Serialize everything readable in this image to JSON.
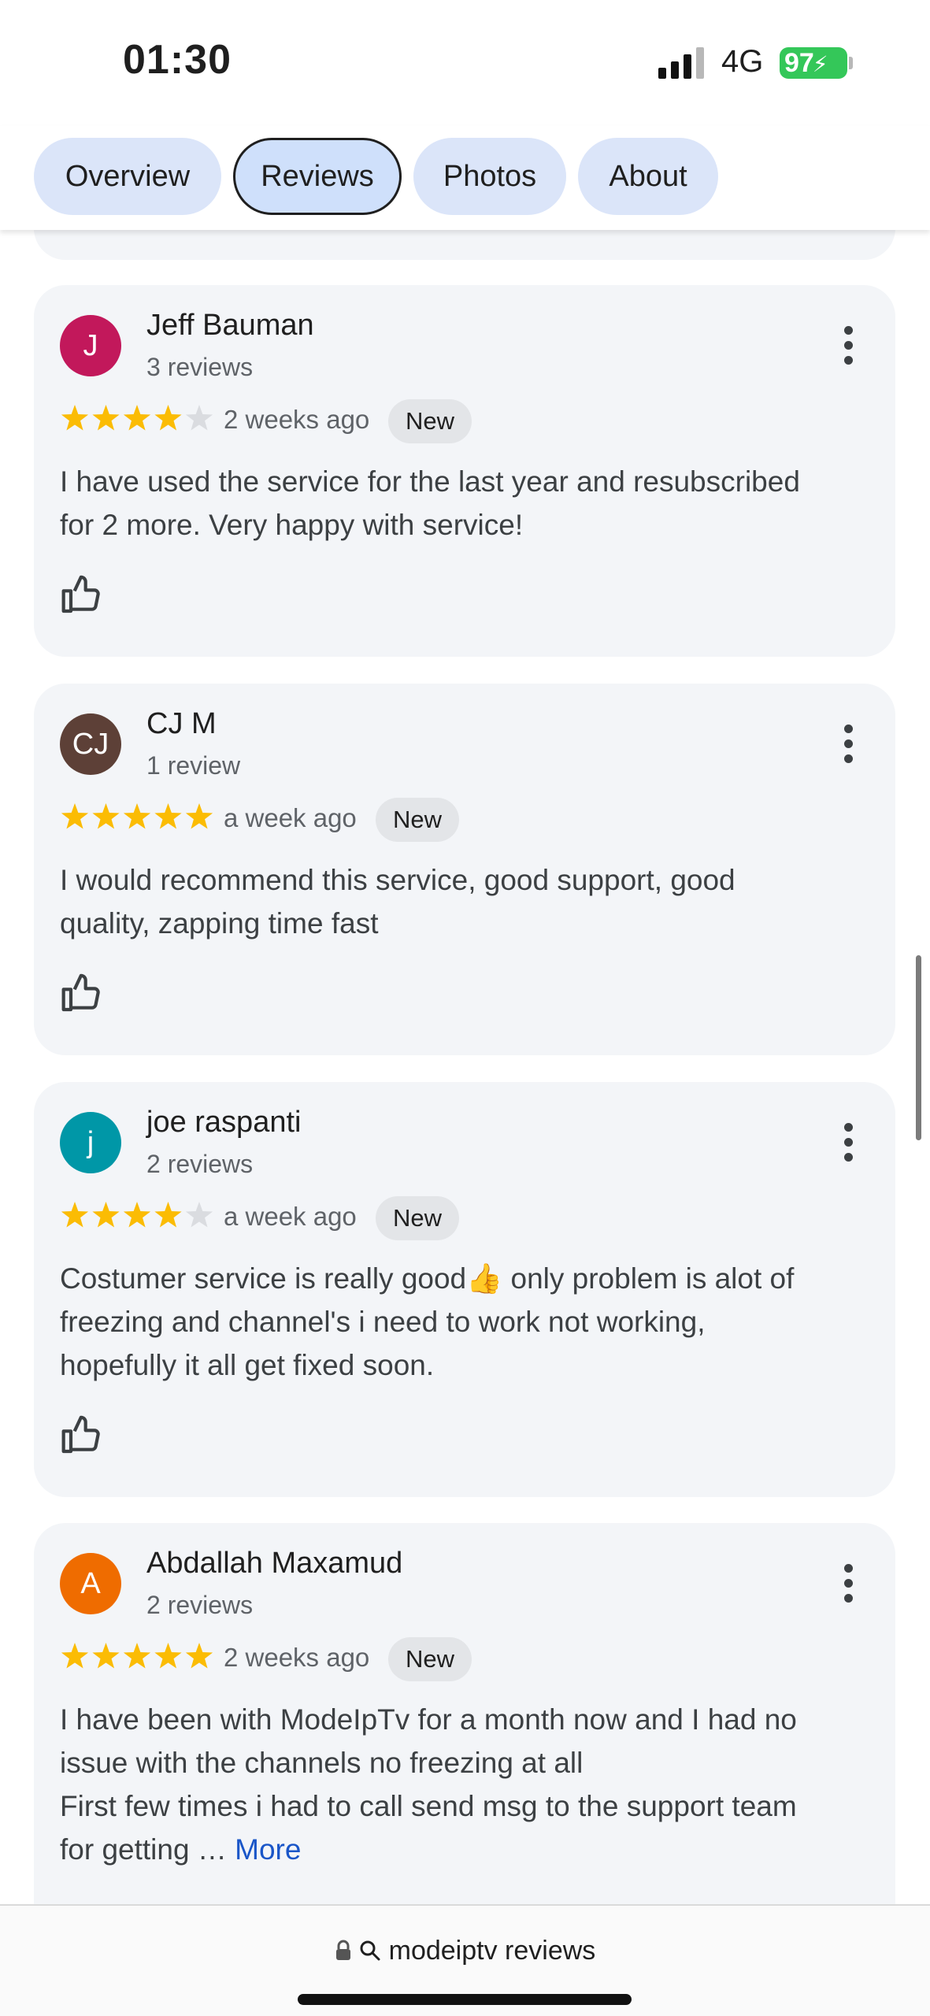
{
  "status_bar": {
    "time": "01:30",
    "network": "4G",
    "battery": "97"
  },
  "tabs": [
    {
      "label": "Overview"
    },
    {
      "label": "Reviews",
      "active": true
    },
    {
      "label": "Photos"
    },
    {
      "label": "About"
    }
  ],
  "reviews": [
    {
      "initial": "J",
      "avatar_color": "#c2185b",
      "name": "Jeff Bauman",
      "count": "3 reviews",
      "rating": 4,
      "date": "2 weeks ago",
      "badge": "New",
      "text_lines": [
        "I have used the service for the last year and resubscribed",
        "for 2 more. Very happy with service!"
      ]
    },
    {
      "initial": "CJ",
      "avatar_color": "#5d4037",
      "name": "CJ M",
      "count": "1 review",
      "rating": 5,
      "date": "a week ago",
      "badge": "New",
      "text_lines": [
        "I would recommend this service, good support, good",
        "quality, zapping time fast"
      ]
    },
    {
      "initial": "j",
      "avatar_color": "#0097a7",
      "name": "joe raspanti",
      "count": "2 reviews",
      "rating": 4,
      "date": "a week ago",
      "badge": "New",
      "text_lines": [
        "Costumer service is really good👍 only problem is alot of",
        "freezing and channel's i need to work not working,",
        "hopefully it all get fixed soon."
      ]
    },
    {
      "initial": "A",
      "avatar_color": "#ef6c00",
      "name": "Abdallah Maxamud",
      "count": "2 reviews",
      "rating": 5,
      "date": "2 weeks ago",
      "badge": "New",
      "text_lines": [
        "I have been with ModeIpTv for a month now and I had no",
        "issue with the channels no freezing at all",
        "First few times i had to call send msg to the support team",
        "for getting …"
      ],
      "more_label": "More"
    }
  ],
  "colors": {
    "star_filled": "#fbbc04",
    "star_empty": "#dadce0",
    "link": "#1a56c8"
  },
  "address_bar": {
    "url": "modeiptv reviews",
    "icons": [
      "lock-icon",
      "search-icon"
    ]
  }
}
